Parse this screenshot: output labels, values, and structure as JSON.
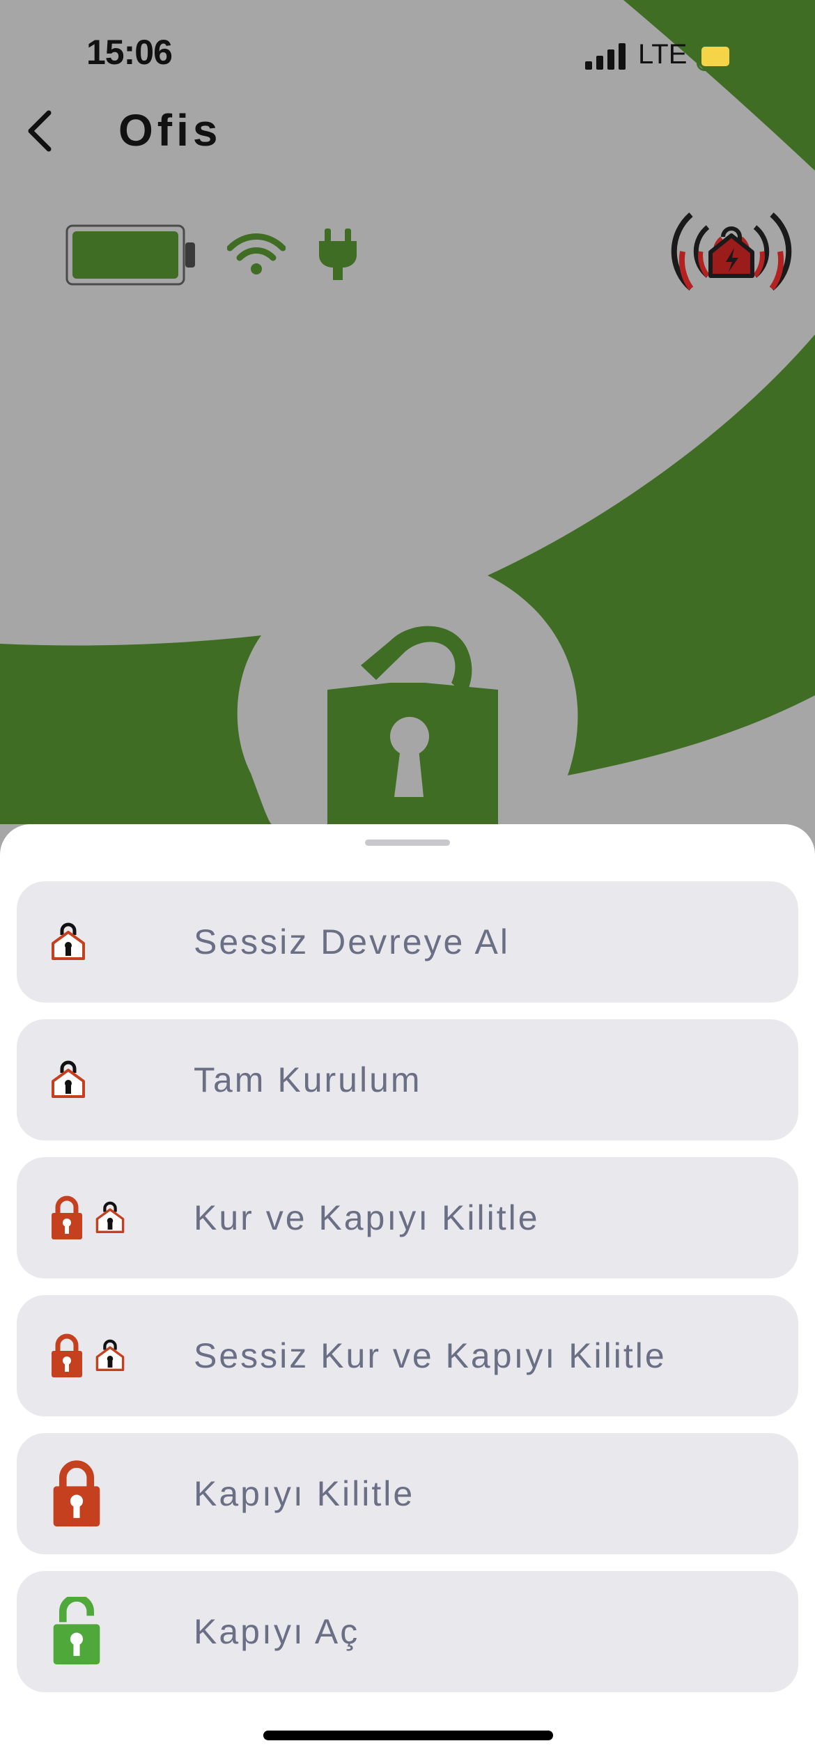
{
  "status_bar": {
    "time": "15:06",
    "network": "LTE",
    "signal_icon": "cellular-signal-icon",
    "battery_icon": "phone-battery-icon",
    "battery_color": "#f5d547"
  },
  "header": {
    "title": "Ofis",
    "back_icon": "chevron-left-icon"
  },
  "device_status": {
    "battery_icon": "device-battery-full-icon",
    "wifi_icon": "wifi-icon",
    "power_icon": "power-plug-icon",
    "alarm_icon": "alarm-armed-home-icon",
    "lock_state_icon": "unlocked-padlock-icon"
  },
  "colors": {
    "background_gray": "#a6a6a6",
    "brand_green": "#3f6d24",
    "action_bg": "#e9e9ed",
    "action_text": "#6b6f85",
    "lock_red": "#c4401e",
    "unlock_green": "#4fa83a"
  },
  "actions": [
    {
      "label": "Sessiz Devreye Al",
      "icons": [
        "home-lock-icon"
      ]
    },
    {
      "label": "Tam Kurulum",
      "icons": [
        "home-lock-icon"
      ]
    },
    {
      "label": "Kur ve Kapıyı Kilitle",
      "icons": [
        "padlock-closed-icon",
        "home-lock-icon"
      ]
    },
    {
      "label": "Sessiz Kur ve Kapıyı Kilitle",
      "icons": [
        "padlock-closed-icon",
        "home-lock-icon"
      ]
    },
    {
      "label": "Kapıyı Kilitle",
      "icons": [
        "padlock-closed-icon"
      ]
    },
    {
      "label": "Kapıyı Aç",
      "icons": [
        "padlock-open-icon"
      ]
    }
  ]
}
